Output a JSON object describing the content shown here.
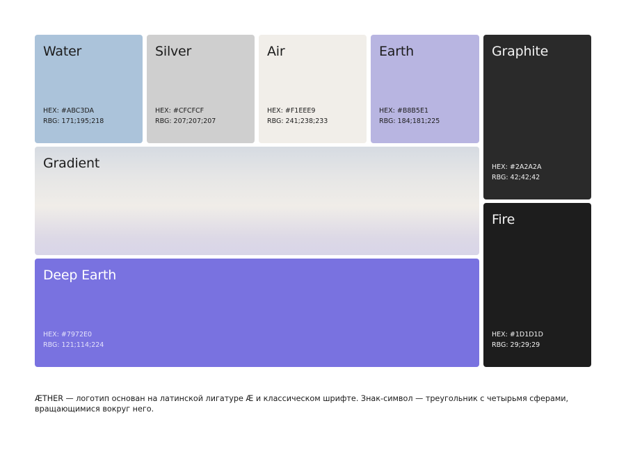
{
  "swatches": {
    "water": {
      "name": "Water",
      "hex": "HEX: #ABC3DA",
      "rgb": "RBG: 171;195;218",
      "color": "#ABC3DA"
    },
    "silver": {
      "name": "Silver",
      "hex": "HEX: #CFCFCF",
      "rgb": "RBG: 207;207;207",
      "color": "#CFCFCF"
    },
    "air": {
      "name": "Air",
      "hex": "HEX: #F1EEE9",
      "rgb": "RBG: 241;238;233",
      "color": "#F1EEE9"
    },
    "earth": {
      "name": "Earth",
      "hex": "HEX: #B8B5E1",
      "rgb": "RBG: 184;181;225",
      "color": "#B8B5E1"
    },
    "graphite": {
      "name": "Graphite",
      "hex": "HEX: #2A2A2A",
      "rgb": "RBG: 42;42;42",
      "color": "#2A2A2A"
    },
    "gradient": {
      "name": "Gradient"
    },
    "fire": {
      "name": "Fire",
      "hex": "HEX: #1D1D1D",
      "rgb": "RBG: 29;29;29",
      "color": "#1D1D1D"
    },
    "deep_earth": {
      "name": "Deep Earth",
      "hex": "HEX: #7972E0",
      "rgb": "RBG: 121;114;224",
      "color": "#7972E0"
    }
  },
  "caption": "ÆTHER — логотип основан на латинской лигатуре Æ и классическом шрифте. Знак-символ — треугольник с четырьмя сферами, вращающимися вокруг него."
}
